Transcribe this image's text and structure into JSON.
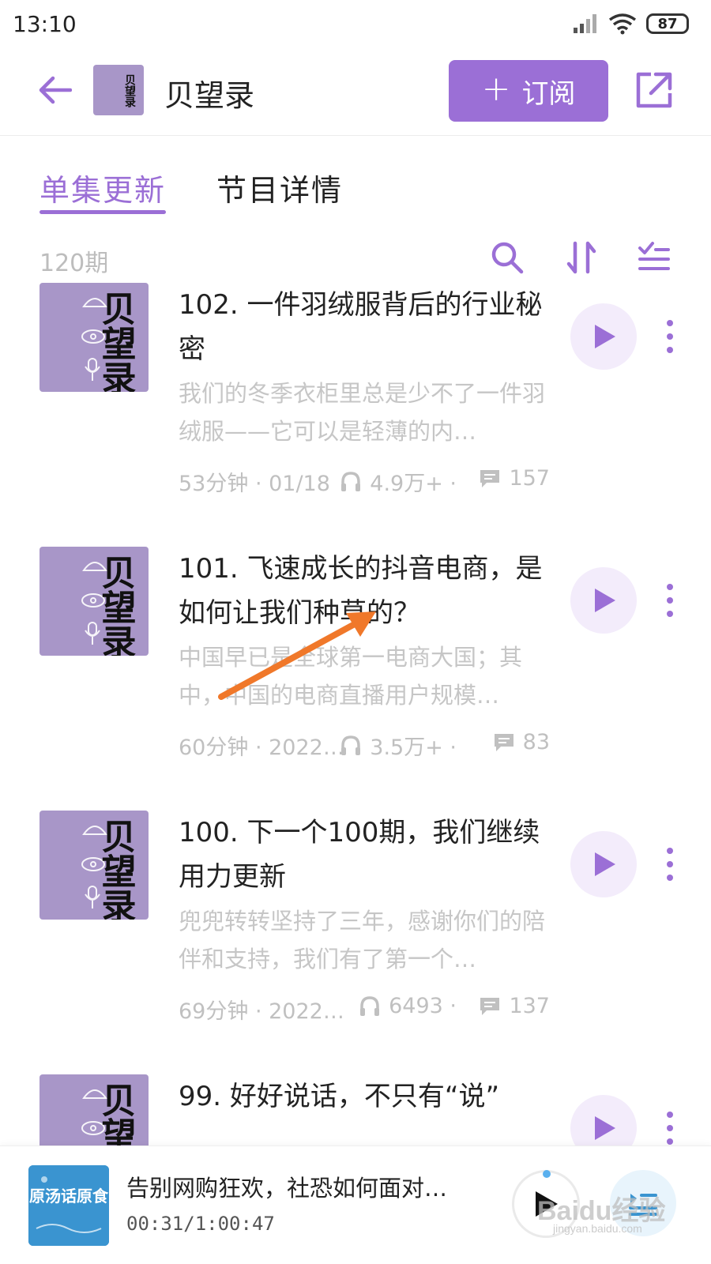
{
  "status_bar": {
    "time": "13:10",
    "battery": "87"
  },
  "header": {
    "title": "贝望录",
    "cover_text": "贝望录",
    "subscribe_label": "订阅",
    "accent_color": "#9b6fd6"
  },
  "tabs": [
    {
      "label": "单集更新",
      "active": true
    },
    {
      "label": "节目详情",
      "active": false
    }
  ],
  "list": {
    "episode_count": "120期"
  },
  "episodes": [
    {
      "title": "102. 一件羽绒服背后的行业秘密",
      "description": "我们的冬季衣柜里总是少不了一件羽绒服——它可以是轻薄的内…",
      "duration_date": "53分钟 · 01/18",
      "plays": "4.9万+ ·",
      "comments": "157",
      "cover_text": "贝望录"
    },
    {
      "title": "101. 飞速成长的抖音电商，是如何让我们种草的？",
      "description": "中国早已是全球第一电商大国；其中，中国的电商直播用户规模…",
      "duration_date": "60分钟 · 2022/…",
      "plays": "3.5万+ ·",
      "comments": "83",
      "cover_text": "贝望录"
    },
    {
      "title": "100. 下一个100期，我们继续用力更新",
      "description": "兜兜转转坚持了三年，感谢你们的陪伴和支持，我们有了第一个…",
      "duration_date": "69分钟 · 2022/…",
      "plays": "6493 ·",
      "comments": "137",
      "cover_text": "贝望录"
    },
    {
      "title": "99. 好好说话，不只有“说”",
      "description": "",
      "duration_date": "",
      "plays": "",
      "comments": "",
      "cover_text": "贝望录"
    }
  ],
  "player": {
    "title": "告别网购狂欢，社恐如何面对…",
    "time": "00:31/1:00:47",
    "cover_text": "原汤话原食"
  },
  "watermark": {
    "main": "Baidu经验",
    "sub": "jingyan.baidu.com"
  }
}
